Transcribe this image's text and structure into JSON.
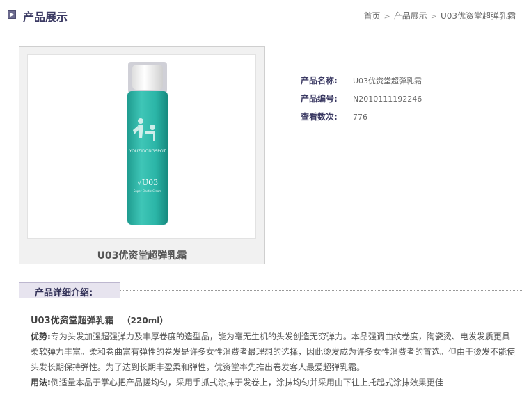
{
  "header": {
    "title": "产品展示"
  },
  "breadcrumb": {
    "home": "首页",
    "section": "产品展示",
    "current": "U03优资堂超弹乳霜",
    "separator": ">"
  },
  "product": {
    "image_caption": "U03优资堂超弹乳霜",
    "bottle_texts": {
      "brand": "YOUZIDONGSPOT",
      "model": "√U03",
      "subtitle": "Super Elastic Cream"
    },
    "info": [
      {
        "label": "产品名称:",
        "value": "U03优资堂超弹乳霜"
      },
      {
        "label": "产品编号:",
        "value": "N2010111192246"
      },
      {
        "label": "查看数次:",
        "value": "776"
      }
    ]
  },
  "detail": {
    "tab_title": "产品详细介绍:",
    "product_name": "U03优资堂超弹乳霜",
    "spec": "（220ml）",
    "advantage_label": "优势:",
    "advantage_text": "专为头发加强超强弹力及丰厚卷度的造型品，能为毫无生机的头发创造无穷弹力。本品强调曲纹卷度，陶瓷烫、电发发质更具柔软弹力丰富。柔和卷曲富有弹性的卷发是许多女性消费者最理想的选择，因此烫发成为许多女性消费者的首选。但由于烫发不能使头发长期保持弹性。为了达到长期丰盈柔和弹性，优资堂率先推出卷发客人最爱超弹乳霜。",
    "usage_label": "用法:",
    "usage_text": "倒适量本品于掌心把产品搓均匀，采用手抓式涂抹于发卷上，涂抹均匀并采用由下往上托起式涂抹效果更佳"
  },
  "colors": {
    "accent": "#3b3a63",
    "tab_bg": "#e7e4ef",
    "bottle_teal": "#2bb5a7"
  }
}
